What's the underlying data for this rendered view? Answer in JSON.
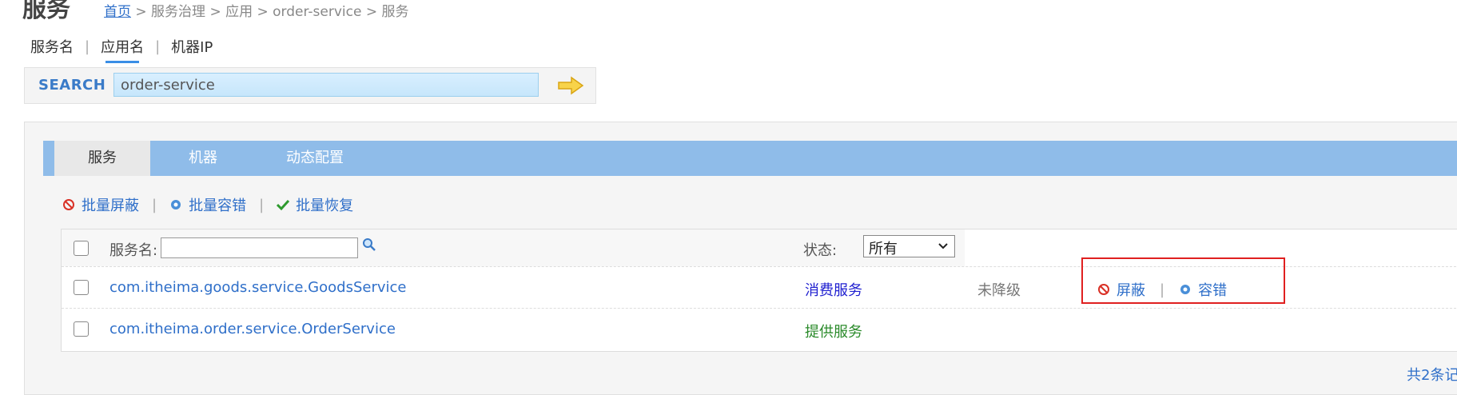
{
  "page": {
    "title": "服务"
  },
  "breadcrumb": {
    "home": "首页",
    "rest": " > 服务治理 > 应用 > order-service > 服务"
  },
  "search": {
    "tabs": [
      "服务名",
      "应用名",
      "机器IP"
    ],
    "active_tab": "应用名",
    "label": "SEARCH",
    "value": "order-service"
  },
  "tabs": [
    "服务",
    "机器",
    "动态配置"
  ],
  "batch_actions": [
    "批量屏蔽",
    "批量容错",
    "批量恢复"
  ],
  "table": {
    "filter_label": "服务名:",
    "status_label": "状态:",
    "status_value": "所有",
    "rows": [
      {
        "service": "com.itheima.goods.service.GoodsService",
        "role": "消费服务",
        "role_color": "#2020d0",
        "degrade": "未降级",
        "actions": [
          "屏蔽",
          "容错"
        ]
      },
      {
        "service": "com.itheima.order.service.OrderService",
        "role": "提供服务",
        "role_color": "#2a8a2a",
        "degrade": "",
        "actions": []
      }
    ]
  },
  "total": "共2条记"
}
